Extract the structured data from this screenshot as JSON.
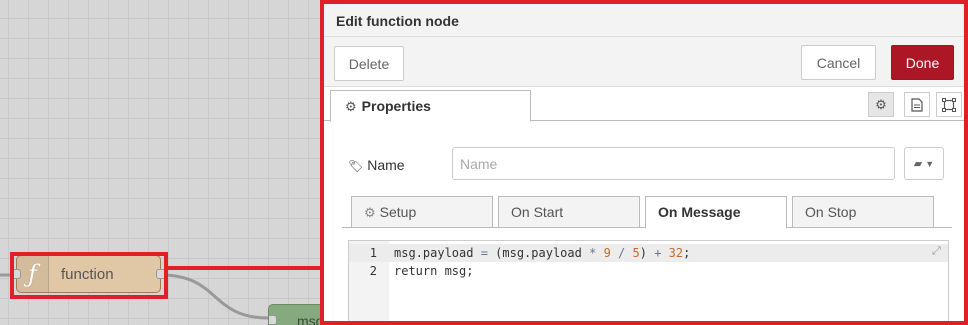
{
  "canvas": {
    "function_node_label": "function",
    "function_node_icon": "ƒ",
    "debug_node_label": "msg",
    "colors": {
      "function_node": "#e0c8a6",
      "debug_node": "#87a980",
      "highlight": "#e02028"
    }
  },
  "tray": {
    "title": "Edit function node",
    "delete_label": "Delete",
    "cancel_label": "Cancel",
    "done_label": "Done",
    "properties_tab_label": "Properties",
    "icons": [
      "gear-icon",
      "description-icon",
      "appearance-icon"
    ],
    "name_label": "Name",
    "name_placeholder": "Name",
    "name_value": "",
    "subtabs": [
      {
        "label": "Setup",
        "icon": "gear-icon"
      },
      {
        "label": "On Start"
      },
      {
        "label": "On Message",
        "active": true
      },
      {
        "label": "On Stop"
      }
    ],
    "editor": {
      "lines": [
        {
          "num": "1",
          "parts": [
            [
              "msg.payload ",
              ""
            ],
            [
              "=",
              "op"
            ],
            [
              " (msg.payload ",
              ""
            ],
            [
              "*",
              "op"
            ],
            [
              " ",
              ""
            ],
            [
              "9",
              "num"
            ],
            [
              " ",
              ""
            ],
            [
              "/",
              "op"
            ],
            [
              " ",
              ""
            ],
            [
              "5",
              "num"
            ],
            [
              ") ",
              ""
            ],
            [
              "+",
              "op"
            ],
            [
              " ",
              ""
            ],
            [
              "32",
              "num"
            ],
            [
              ";",
              ""
            ]
          ]
        },
        {
          "num": "2",
          "parts": [
            [
              "return msg;",
              ""
            ]
          ]
        }
      ]
    },
    "colors": {
      "done_button": "#ad1625"
    }
  }
}
